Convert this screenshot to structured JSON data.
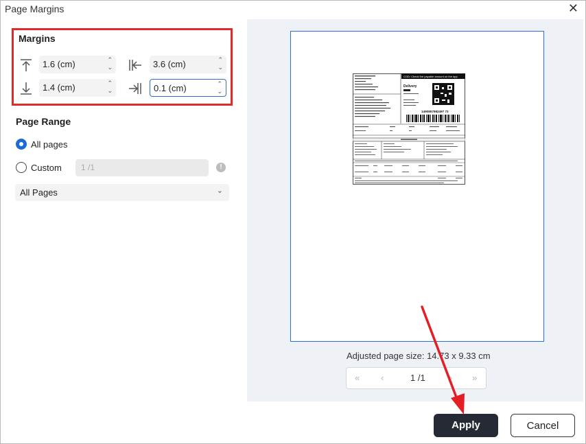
{
  "window": {
    "title": "Page Margins",
    "close_glyph": "✕"
  },
  "margins": {
    "section_title": "Margins",
    "top": {
      "value": "1.6 (cm)",
      "icon": "margin-top-icon"
    },
    "left": {
      "value": "3.6 (cm)",
      "icon": "margin-left-icon"
    },
    "bottom": {
      "value": "1.4 (cm)",
      "icon": "margin-bottom-icon"
    },
    "right": {
      "value": "0.1 (cm)",
      "icon": "margin-right-icon"
    }
  },
  "page_range": {
    "section_title": "Page Range",
    "all_pages_label": "All pages",
    "custom_label": "Custom",
    "custom_placeholder": "1 /1",
    "selected": "all",
    "subset_select": "All Pages"
  },
  "preview": {
    "adjusted_size": "Adjusted page size: 14.73 x 9.33 cm",
    "page_indicator": "1 /1",
    "shipping_label": {
      "banner": "COD: Check the payable amount on the app",
      "service": "Delivery",
      "tracking_number": "1490857982497 73"
    }
  },
  "buttons": {
    "apply": "Apply",
    "cancel": "Cancel"
  },
  "colors": {
    "accent": "#2b6fd6",
    "highlight": "#e02b2b",
    "primary_button": "#252a34"
  }
}
